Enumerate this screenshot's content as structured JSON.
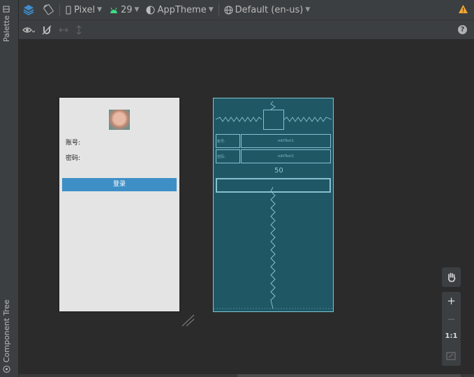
{
  "sidebar": {
    "palette_label": "Palette",
    "component_tree_label": "Component Tree"
  },
  "toolbar": {
    "device": "Pixel",
    "api_level": "29",
    "theme": "AppTheme",
    "locale": "Default (en-us)"
  },
  "zoom": {
    "plus": "+",
    "minus": "−",
    "one_to_one": "1:1"
  },
  "design": {
    "account_label": "账号:",
    "password_label": "密码:",
    "login_button": "登录"
  },
  "blueprint": {
    "account_label": "账号:",
    "password_label": "密码:",
    "edit1": "editText1",
    "edit2": "editText2",
    "marker": "50"
  },
  "colors": {
    "accent": "#3f8fc7",
    "blueprint_bg": "#1f5765",
    "blueprint_line": "#86c1cf"
  }
}
